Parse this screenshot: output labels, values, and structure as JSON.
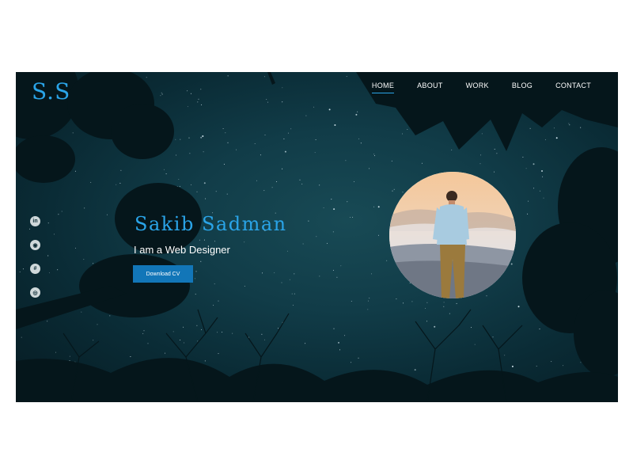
{
  "logo": "S.S",
  "nav": {
    "items": [
      {
        "label": "HOME",
        "active": true
      },
      {
        "label": "ABOUT",
        "active": false
      },
      {
        "label": "WORK",
        "active": false
      },
      {
        "label": "BLOG",
        "active": false
      },
      {
        "label": "CONTACT",
        "active": false
      }
    ]
  },
  "social": [
    {
      "icon": "linkedin-icon",
      "glyph": "in"
    },
    {
      "icon": "github-icon",
      "glyph": "◉"
    },
    {
      "icon": "hash-icon",
      "glyph": "#"
    },
    {
      "icon": "instagram-icon",
      "glyph": "◎"
    }
  ],
  "hero": {
    "name": "Sakib Sadman",
    "subtitle": "I am a Web Designer",
    "button": "Download CV"
  },
  "colors": {
    "accent": "#2aa4e8",
    "button": "#1276b8",
    "background": "#0f3b47"
  }
}
